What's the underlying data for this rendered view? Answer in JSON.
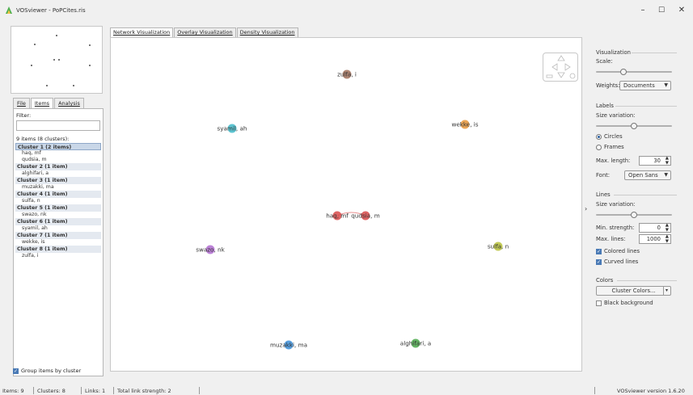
{
  "window": {
    "title": "VOSviewer - PoPCites.ris",
    "minimize": "–",
    "maximize": "☐",
    "close": "✕",
    "icon_color": "#4caf50"
  },
  "left_tabs": [
    {
      "label": "File",
      "active": false
    },
    {
      "label": "Items",
      "active": true
    },
    {
      "label": "Analysis",
      "active": false
    }
  ],
  "items_panel": {
    "filter_label": "Filter:",
    "filter_value": "",
    "count_text": "9 items (8 clusters):",
    "clusters": [
      {
        "label": "Cluster 1 (2 items)",
        "selected": true,
        "items": [
          "haq, mf",
          "qudsia, m"
        ]
      },
      {
        "label": "Cluster 2 (1 item)",
        "items": [
          "alghifari, a"
        ]
      },
      {
        "label": "Cluster 3 (1 item)",
        "items": [
          "muzakki, ma"
        ]
      },
      {
        "label": "Cluster 4 (1 item)",
        "items": [
          "sulfa, n"
        ]
      },
      {
        "label": "Cluster 5 (1 item)",
        "items": [
          "swazo, nk"
        ]
      },
      {
        "label": "Cluster 6 (1 item)",
        "items": [
          "syamil, ah"
        ]
      },
      {
        "label": "Cluster 7 (1 item)",
        "items": [
          "wekke, is"
        ]
      },
      {
        "label": "Cluster 8 (1 item)",
        "items": [
          "zulfa, i"
        ]
      }
    ],
    "group_by_cluster": "Group items by cluster",
    "group_by_cluster_checked": true
  },
  "vis_tabs": [
    {
      "label": "Network Visualization",
      "active": true
    },
    {
      "label": "Overlay Visualization",
      "active": false
    },
    {
      "label": "Density Visualization",
      "active": false
    }
  ],
  "network": {
    "nodes": [
      {
        "label": "zulfa, i",
        "color": "#a0705a"
      },
      {
        "label": "syamil, ah",
        "color": "#3fb8c8"
      },
      {
        "label": "wekke, is",
        "color": "#e8963a"
      },
      {
        "label": "haq, mf",
        "color": "#d84a4a"
      },
      {
        "label": "qudsia, m",
        "color": "#d84a4a"
      },
      {
        "label": "sulfa, n",
        "color": "#b8c23a"
      },
      {
        "label": "swazo, nk",
        "color": "#b06cd0"
      },
      {
        "label": "muzakki, ma",
        "color": "#3b8ed8"
      },
      {
        "label": "alghifari, a",
        "color": "#4aa84a"
      }
    ],
    "links": [
      {
        "from": "haq, mf",
        "to": "qudsia, m",
        "color": "#e89090"
      }
    ]
  },
  "right_panel": {
    "visualization_h": "Visualization",
    "scale_label": "Scale:",
    "scale_value": 0.35,
    "weights_label": "Weights:",
    "weights_value": "Documents",
    "labels_h": "Labels",
    "size_variation_label": "Size variation:",
    "labels_size_variation": 0.5,
    "circles": "Circles",
    "frames": "Frames",
    "circles_selected": true,
    "max_length_label": "Max. length:",
    "max_length_value": "30",
    "font_label": "Font:",
    "font_value": "Open Sans",
    "lines_h": "Lines",
    "lines_size_label": "Size variation:",
    "lines_size_variation": 0.5,
    "min_strength_label": "Min. strength:",
    "min_strength_value": "0",
    "max_lines_label": "Max. lines:",
    "max_lines_value": "1000",
    "colored_lines": "Colored lines",
    "curved_lines": "Curved lines",
    "colors_h": "Colors",
    "cluster_colors_button": "Cluster Colors...",
    "black_background": "Black background"
  },
  "status": {
    "items": "Items:  9",
    "clusters": "Clusters:  8",
    "links": "Links:  1",
    "total_link_strength": "Total link strength:  2",
    "version": "VOSviewer version 1.6.20"
  }
}
